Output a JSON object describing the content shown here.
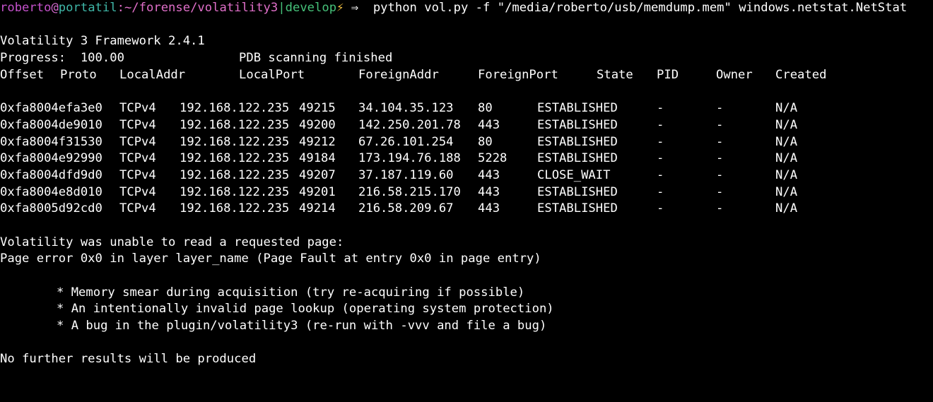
{
  "prompt": {
    "user": "roberto",
    "at": "@",
    "host": "portatil",
    "separator": ":",
    "path": "~/forense/volatility3",
    "pipe": "|",
    "branch": "develop",
    "bolt": "⚡",
    "arrow": " ⇒ ",
    "command": " python vol.py -f \"/media/roberto/usb/memdump.mem\" windows.netstat.NetStat"
  },
  "output": {
    "framework": "Volatility 3 Framework 2.4.1",
    "progress_label": "Progress:  100.00",
    "progress_status": "PDB scanning finished",
    "headers": [
      "Offset",
      "Proto",
      "LocalAddr",
      "LocalPort",
      "ForeignAddr",
      "ForeignPort",
      "State",
      "PID",
      "Owner",
      "Created"
    ],
    "rows": [
      [
        "0xfa8004efa3e0",
        "TCPv4",
        "192.168.122.235",
        "49215",
        "34.104.35.123",
        "80",
        "ESTABLISHED",
        "-",
        "-",
        "N/A"
      ],
      [
        "0xfa8004de9010",
        "TCPv4",
        "192.168.122.235",
        "49200",
        "142.250.201.78",
        "443",
        "ESTABLISHED",
        "-",
        "-",
        "N/A"
      ],
      [
        "0xfa8004f31530",
        "TCPv4",
        "192.168.122.235",
        "49212",
        "67.26.101.254",
        "80",
        "ESTABLISHED",
        "-",
        "-",
        "N/A"
      ],
      [
        "0xfa8004e92990",
        "TCPv4",
        "192.168.122.235",
        "49184",
        "173.194.76.188",
        "5228",
        "ESTABLISHED",
        "-",
        "-",
        "N/A"
      ],
      [
        "0xfa8004dfd9d0",
        "TCPv4",
        "192.168.122.235",
        "49207",
        "37.187.119.60",
        "443",
        "CLOSE_WAIT",
        "-",
        "-",
        "N/A"
      ],
      [
        "0xfa8004e8d010",
        "TCPv4",
        "192.168.122.235",
        "49201",
        "216.58.215.170",
        "443",
        "ESTABLISHED",
        "-",
        "-",
        "N/A"
      ],
      [
        "0xfa8005d92cd0",
        "TCPv4",
        "192.168.122.235",
        "49214",
        "216.58.209.67",
        "443",
        "ESTABLISHED",
        "-",
        "-",
        "N/A"
      ]
    ],
    "error_title": "Volatility was unable to read a requested page:",
    "error_detail": "Page error 0x0 in layer layer_name (Page Fault at entry 0x0 in page entry)",
    "bullets": [
      "* Memory smear during acquisition (try re-acquiring if possible)",
      "* An intentionally invalid page lookup (operating system protection)",
      "* A bug in the plugin/volatility3 (re-run with -vvv and file a bug)"
    ],
    "final": "No further results will be produced"
  },
  "colors": {
    "background": "#000000",
    "text": "#ffffff",
    "user": "#c552cc",
    "host": "#3fb7a8",
    "branch": "#46c27a",
    "bolt": "#f5c242"
  }
}
